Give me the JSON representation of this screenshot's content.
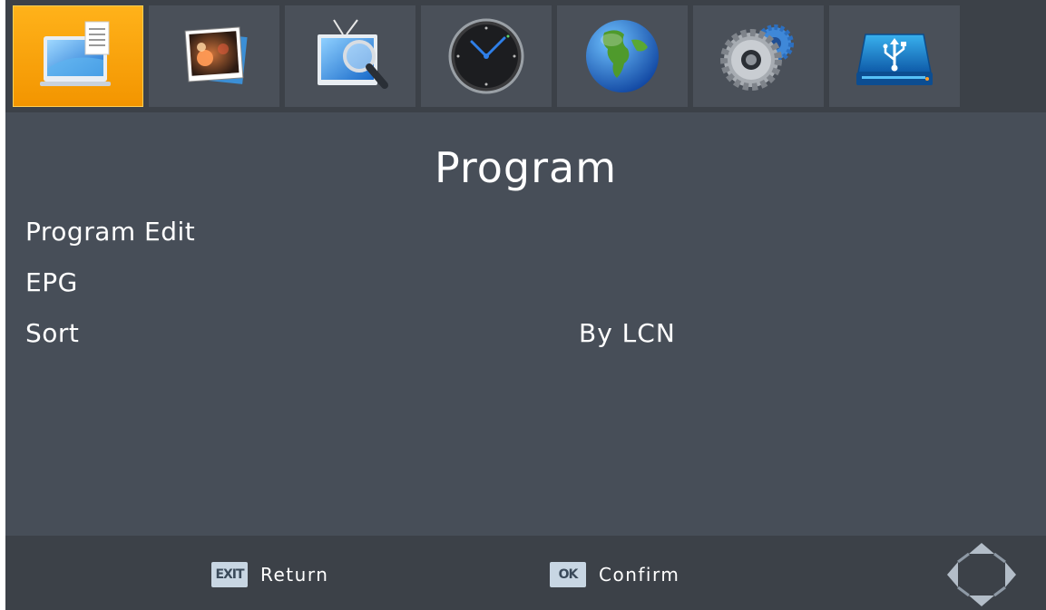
{
  "tabs": [
    {
      "icon": "program-icon",
      "active": true
    },
    {
      "icon": "picture-icon",
      "active": false
    },
    {
      "icon": "channel-search-icon",
      "active": false
    },
    {
      "icon": "clock-icon",
      "active": false
    },
    {
      "icon": "globe-icon",
      "active": false
    },
    {
      "icon": "settings-gears-icon",
      "active": false
    },
    {
      "icon": "usb-icon",
      "active": false
    }
  ],
  "page": {
    "title": "Program"
  },
  "menu": [
    {
      "label": "Program Edit",
      "value": ""
    },
    {
      "label": "EPG",
      "value": ""
    },
    {
      "label": "Sort",
      "value": "By LCN"
    }
  ],
  "footer": {
    "exit_key": "EXIT",
    "exit_label": "Return",
    "ok_key": "OK",
    "ok_label": "Confirm",
    "dpad_icon": "dpad-navigation-icon"
  },
  "colors": {
    "active_tab": "#f7a20a",
    "background": "#474e58",
    "bar": "#3c4148",
    "text": "#ffffff"
  }
}
